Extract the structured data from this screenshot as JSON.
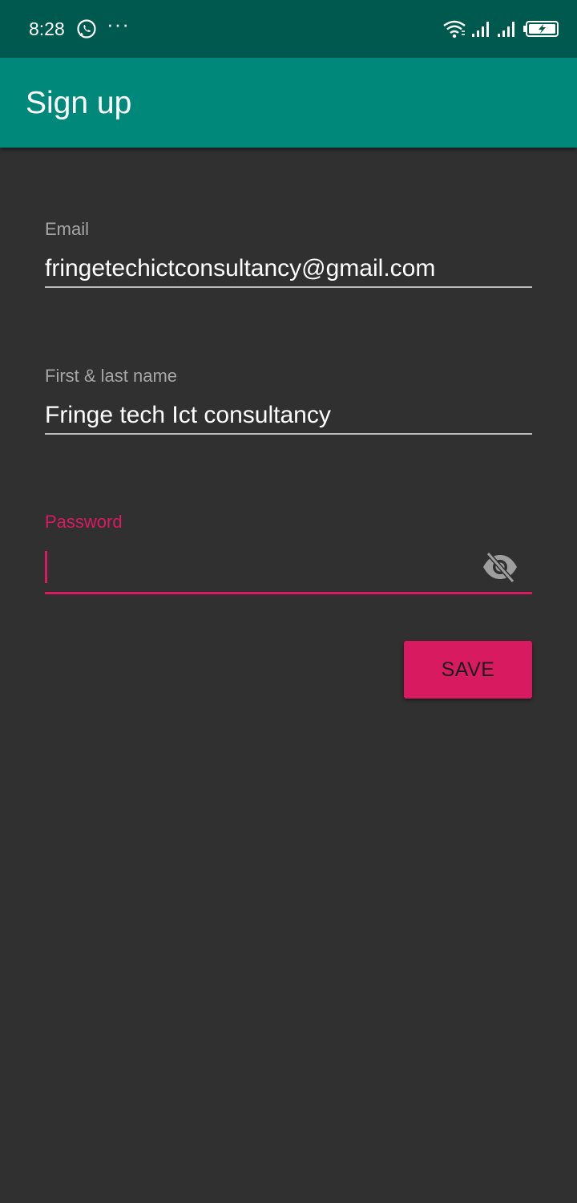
{
  "status_bar": {
    "time": "8:28",
    "icons": [
      "whatsapp-icon",
      "more-dots-icon",
      "wifi-icon",
      "signal-icon",
      "signal-icon",
      "battery-charging-icon"
    ],
    "dots": "···"
  },
  "app_bar": {
    "title": "Sign up",
    "background_color": "#00897b",
    "status_color": "#00594f"
  },
  "form": {
    "email": {
      "label": "Email",
      "value": "fringetechictconsultancy@gmail.com"
    },
    "name": {
      "label": "First & last name",
      "value": "Fringe tech Ict consultancy"
    },
    "password": {
      "label": "Password",
      "value": "",
      "focused": true,
      "visibility_icon": "visibility-off-icon"
    },
    "save_label": "SAVE"
  },
  "colors": {
    "accent": "#d81b60",
    "background": "#303030"
  }
}
